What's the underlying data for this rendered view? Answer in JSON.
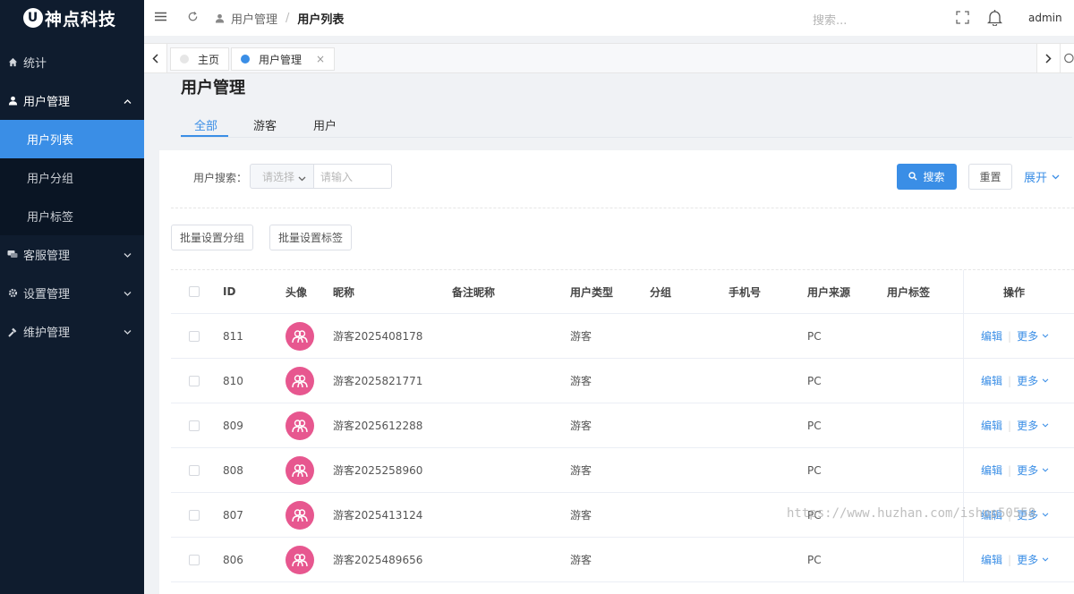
{
  "brand": {
    "logo_letter": "U",
    "name": "神点科技"
  },
  "sidebar": {
    "items": [
      {
        "label": "统计",
        "icon": "home-icon"
      },
      {
        "label": "用户管理",
        "icon": "user-icon",
        "open": true
      },
      {
        "label": "客服管理",
        "icon": "chat-icon"
      },
      {
        "label": "设置管理",
        "icon": "gear-icon"
      },
      {
        "label": "维护管理",
        "icon": "wrench-icon"
      }
    ],
    "subitems": [
      {
        "label": "用户列表",
        "active": true
      },
      {
        "label": "用户分组"
      },
      {
        "label": "用户标签"
      }
    ]
  },
  "header": {
    "breadcrumb": {
      "parent": "用户管理",
      "separator": "/",
      "current": "用户列表"
    },
    "search_placeholder": "搜索...",
    "user": "admin"
  },
  "page_tabs": [
    {
      "label": "主页",
      "dot_color": "#e6e6e6"
    },
    {
      "label": "用户管理",
      "dot_color": "#3a8ee6",
      "closable": true,
      "close_glyph": "×"
    }
  ],
  "page": {
    "title": "用户管理",
    "segment_tabs": [
      "全部",
      "游客",
      "用户"
    ],
    "active_segment": "全部"
  },
  "filter": {
    "label": "用户搜索：",
    "select_placeholder": "请选择",
    "input_placeholder": "请输入",
    "search_button": "搜索",
    "reset_button": "重置",
    "expand_link": "展开"
  },
  "batch": {
    "group_button": "批量设置分组",
    "tag_button": "批量设置标签"
  },
  "table": {
    "columns": [
      "ID",
      "头像",
      "昵称",
      "备注昵称",
      "用户类型",
      "分组",
      "手机号",
      "用户来源",
      "用户标签",
      "操作"
    ],
    "rows": [
      {
        "id": "811",
        "nickname": "游客2025408178",
        "remark": "",
        "type": "游客",
        "group": "",
        "phone": "",
        "source": "PC",
        "tags": ""
      },
      {
        "id": "810",
        "nickname": "游客2025821771",
        "remark": "",
        "type": "游客",
        "group": "",
        "phone": "",
        "source": "PC",
        "tags": ""
      },
      {
        "id": "809",
        "nickname": "游客2025612288",
        "remark": "",
        "type": "游客",
        "group": "",
        "phone": "",
        "source": "PC",
        "tags": ""
      },
      {
        "id": "808",
        "nickname": "游客2025258960",
        "remark": "",
        "type": "游客",
        "group": "",
        "phone": "",
        "source": "PC",
        "tags": ""
      },
      {
        "id": "807",
        "nickname": "游客2025413124",
        "remark": "",
        "type": "游客",
        "group": "",
        "phone": "",
        "source": "PC",
        "tags": ""
      },
      {
        "id": "806",
        "nickname": "游客2025489656",
        "remark": "",
        "type": "游客",
        "group": "",
        "phone": "",
        "source": "PC",
        "tags": ""
      }
    ],
    "op_edit": "编辑",
    "op_more": "更多",
    "op_separator": "|"
  },
  "watermark": "https://www.huzhan.com/ishop50558",
  "colors": {
    "sidebar_bg": "#0f1c2e",
    "primary": "#3a8ee6",
    "avatar": "#e7578f"
  }
}
